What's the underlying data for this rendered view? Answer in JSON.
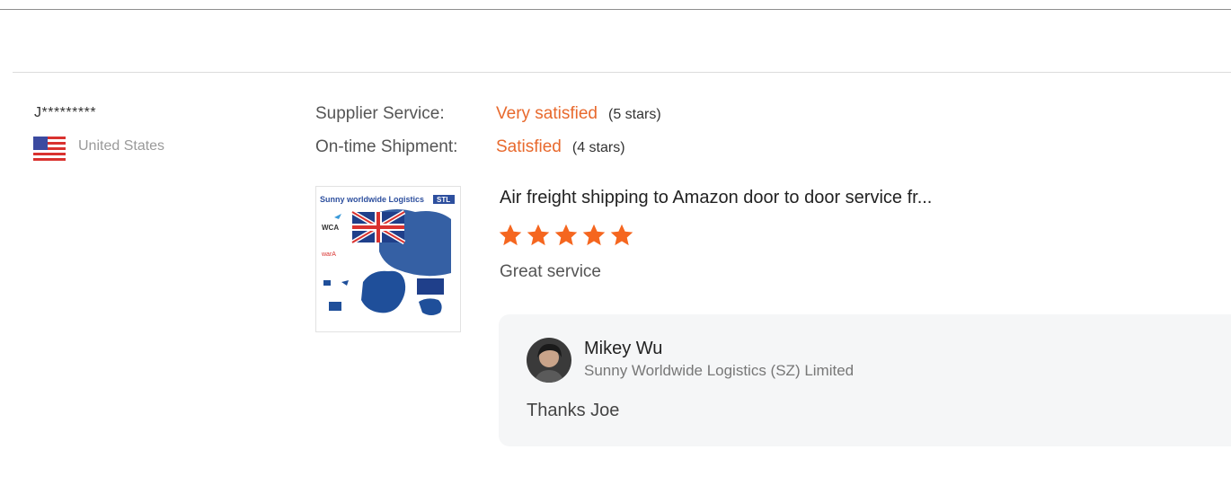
{
  "buyer": {
    "name": "J*********",
    "country": "United States",
    "flag_icon": "us-flag-icon"
  },
  "ratings": {
    "supplier_service": {
      "label": "Supplier Service:",
      "value": "Very satisfied",
      "stars": "(5 stars)"
    },
    "ontime_shipment": {
      "label": "On-time Shipment:",
      "value": "Satisfied",
      "stars": "(4 stars)"
    }
  },
  "product": {
    "title": "Air freight shipping to Amazon door to door service fr...",
    "image_caption": "Sunny worldwide Logistics",
    "image_badge": "STL",
    "image_wca": "WCA",
    "image_wara": "warA",
    "rating": 5
  },
  "review": {
    "text": "Great service"
  },
  "reply": {
    "name": "Mikey Wu",
    "company": "Sunny Worldwide Logistics (SZ) Limited",
    "text": "Thanks Joe"
  },
  "colors": {
    "accent": "#e8692d",
    "star": "#f5661f",
    "reply_bg": "#f5f6f7"
  }
}
